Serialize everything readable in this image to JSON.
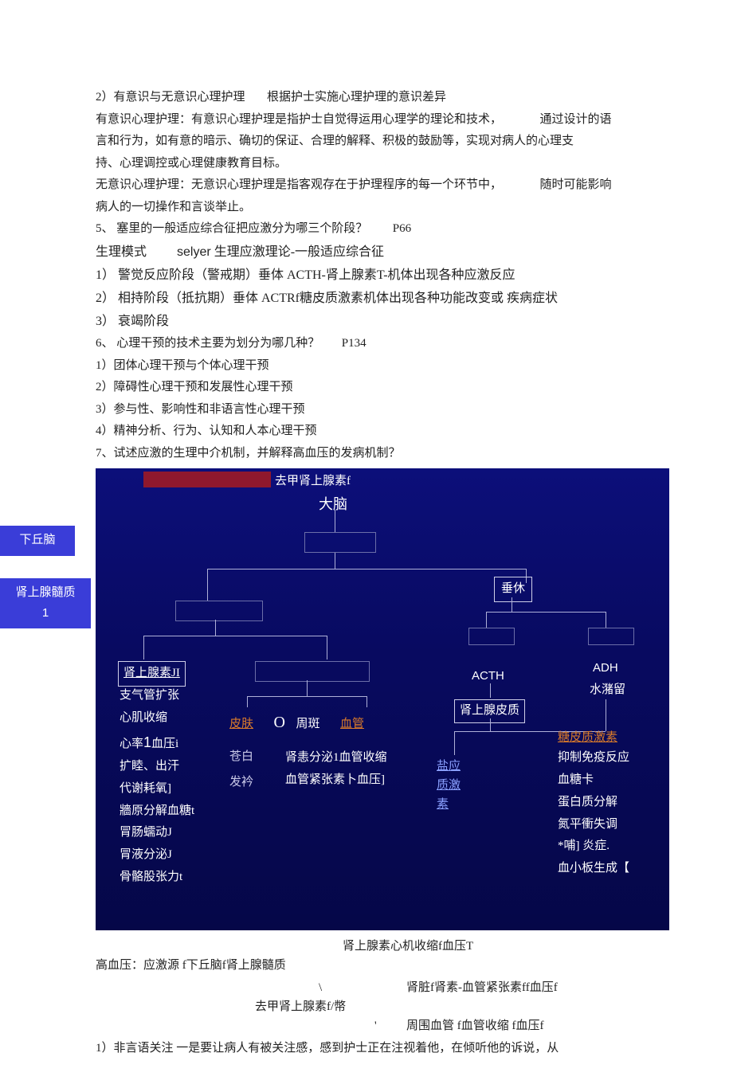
{
  "text": {
    "p1a": "2）有意识与无意识心理护理",
    "p1b": "根据护士实施心理护理的意识差异",
    "p2a": "有意识心理护理：有意识心理护理是指护士自觉得运用心理学的理论和技术，",
    "p2b": "通过设计的语",
    "p3": "言和行为，如有意的暗示、确切的保证、合理的解释、积极的鼓励等，实现对病人的心理支",
    "p4": "持、心理调控或心理健康教育目标。",
    "p5a": "无意识心理护理：无意识心理护理是指客观存在于护理程序的每一个环节中，",
    "p5b": "随时可能影响",
    "p6": "病人的一切操作和言谈举止。",
    "p7a": "5、 塞里的一般适应综合征把应激分为哪三个阶段？",
    "p7b": "P66",
    "p8a": "生理模式",
    "p8b": "selyer",
    "p8c": " 生理应激理论-一般适应综合征",
    "p9": "1）  警觉反应阶段（警戒期）垂体 ACTH-肾上腺素T-机体出现各种应激反应",
    "p10": "2）  相持阶段（抵抗期）垂体 ACTRf糖皮质激素机体出现各种功能改变或  疾病症状",
    "p11": "3）  衰竭阶段",
    "p12a": "6、 心理干预的技术主要为划分为哪几种？",
    "p12b": "P134",
    "p13": "1）团体心理干预与个体心理干预",
    "p14": "2）障碍性心理干预和发展性心理干预",
    "p15": "3）参与性、影响性和非语言性心理干预",
    "p16": "4）精神分析、行为、认知和人本心理干预",
    "p17": "7、试述应激的生理中介机制，并解释高血压的发病机制？"
  },
  "sideTags": {
    "t1": "下丘脑",
    "t2": "肾上腺髓质",
    "t2num": "1"
  },
  "diagram": {
    "top1": "去甲肾上腺素f",
    "top2": "大脑",
    "chuiti": "垂休",
    "leftBoxLabel": "肾上腺素JI",
    "leftList1": "支气管扩张",
    "leftList2": "心肌收缩",
    "leftList3a": "心率",
    "leftList3b": "1",
    "leftList3c": "血压i",
    "leftList4": "扩睦、出汗",
    "leftList5": "代谢耗氧]",
    "leftList6": "牆原分解血糖t",
    "leftList7": "冐肠蠕动J",
    "leftList8": "冐液分泌J",
    "leftList9": "骨骼股张力t",
    "midSkin": "皮肤",
    "midO": "O",
    "midZhouban": "周斑",
    "midXueguan": "血管",
    "midPale": "苍白",
    "midFaxin": "发衿",
    "midLine1": "肾恚分泌1血管收缩",
    "midLine2": "血管紧张素卜血压]",
    "acth": "ACTH",
    "adh": "ADH",
    "shuili": "水潴留",
    "shenshangxian": "肾上腺皮质",
    "yanying": "盐应",
    "zhiji": "质激",
    "su": "素",
    "tangpizhi": "糖皮质激素",
    "r1": "抑制免疫反应",
    "r2": "血糖卡",
    "r3": "蛋白质分解",
    "r4": "氮平衝失调",
    "r5": "*哺] 炎症.",
    "r6": "血小板生成【"
  },
  "after": {
    "a1": "肾上腺素心机收缩f血压T",
    "a2": "高血压：应激源 f下丘脑f肾上腺髓质",
    "a3slash": "\\",
    "a3txt": "肾脏f肾素-血管紧张素ff血压f",
    "a4": "去甲肾上腺素f/幣",
    "a5comma": "'",
    "a5txt": "周围血管 f血管收缩 f血压f",
    "a6": "1）非言语关注 一是要让病人有被关注感，感到护士正在注视着他，在倾听他的诉说，从"
  }
}
